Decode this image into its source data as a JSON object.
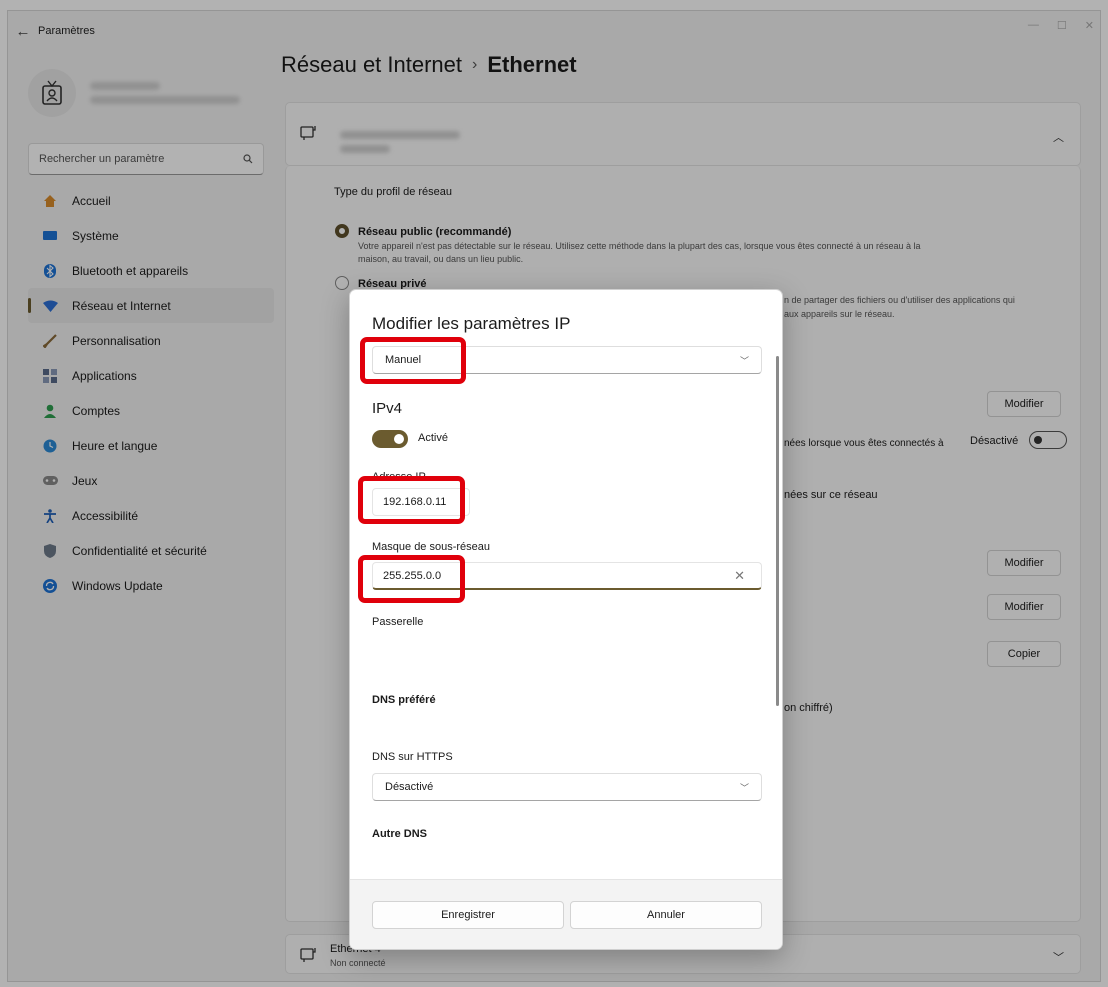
{
  "window": {
    "title": "Paramètres",
    "back_icon": "back-arrow-icon"
  },
  "search": {
    "placeholder": "Rechercher un paramètre",
    "icon": "search-icon"
  },
  "sidebar": {
    "items": [
      {
        "label": "Accueil",
        "icon": "home-icon",
        "color": "#d98b2b"
      },
      {
        "label": "Système",
        "icon": "system-icon",
        "color": "#1e73d6"
      },
      {
        "label": "Bluetooth et appareils",
        "icon": "bluetooth-icon",
        "color": "#1e73d6"
      },
      {
        "label": "Réseau et Internet",
        "icon": "network-icon",
        "color": "#2b6fd6"
      },
      {
        "label": "Personnalisation",
        "icon": "brush-icon",
        "color": "#8a6a3a"
      },
      {
        "label": "Applications",
        "icon": "apps-icon",
        "color": "#5a6a8a"
      },
      {
        "label": "Comptes",
        "icon": "account-icon",
        "color": "#2f9e4f"
      },
      {
        "label": "Heure et langue",
        "icon": "globe-clock-icon",
        "color": "#2b8ad6"
      },
      {
        "label": "Jeux",
        "icon": "gamepad-icon",
        "color": "#777777"
      },
      {
        "label": "Accessibilité",
        "icon": "accessibility-icon",
        "color": "#1e5fb8"
      },
      {
        "label": "Confidentialité et sécurité",
        "icon": "shield-icon",
        "color": "#6d7a8a"
      },
      {
        "label": "Windows Update",
        "icon": "update-icon",
        "color": "#1e73d6"
      }
    ],
    "active_index": 3
  },
  "breadcrumb": {
    "parent": "Réseau et Internet",
    "separator": "›",
    "current": "Ethernet"
  },
  "background": {
    "profile_type_label": "Type du profil de réseau",
    "public_title": "Réseau public (recommandé)",
    "public_desc_1": "Votre appareil n'est pas détectable sur le réseau. Utilisez cette méthode dans la plupart des cas, lorsque vous êtes connecté à un réseau à la",
    "public_desc_2": "maison, au travail, ou dans un lieu public.",
    "private_title": "Réseau privé",
    "private_desc_1": "n de partager des fichiers ou d'utiliser des applications qui",
    "private_desc_2": "aux appareils sur le réseau.",
    "modifier_label": "Modifier",
    "metered_text": "nées lorsque vous êtes connectés à",
    "toggle_off_label": "Désactivé",
    "data_usage_text": "nées sur ce réseau",
    "copier_label": "Copier",
    "encrypted_text": "on chiffré)",
    "ethernet4_title": "Ethernet 4",
    "ethernet4_status": "Non connecté"
  },
  "dialog": {
    "title": "Modifier les paramètres IP",
    "mode_value": "Manuel",
    "ipv4_heading": "IPv4",
    "ipv4_toggle_label": "Activé",
    "ip_label": "Adresse IP",
    "ip_value": "192.168.0.11",
    "mask_label": "Masque de sous-réseau",
    "mask_value": "255.255.0.0",
    "gateway_label": "Passerelle",
    "gateway_value": "",
    "dns_pref_label": "DNS préféré",
    "dns_https_label": "DNS sur HTTPS",
    "dns_https_value": "Désactivé",
    "other_dns_label": "Autre DNS",
    "save_label": "Enregistrer",
    "cancel_label": "Annuler"
  },
  "colors": {
    "accent": "#6b5b2f",
    "highlight": "#e0000b"
  }
}
